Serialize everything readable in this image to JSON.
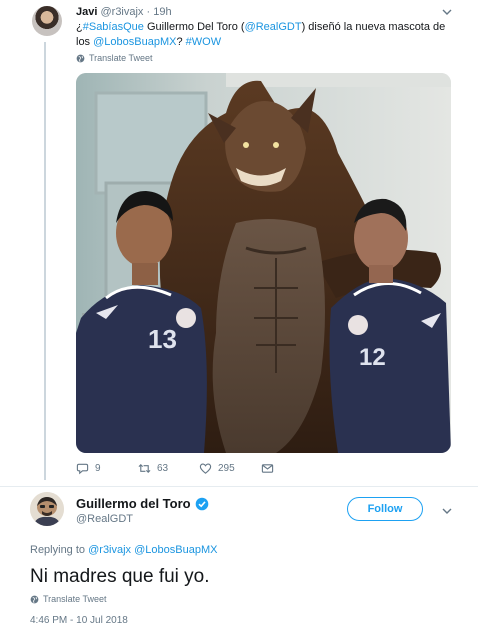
{
  "context_tweet": {
    "author_name": "Javi",
    "handle": "@r3ivajx",
    "separator": "·",
    "age": "19h",
    "text_parts": [
      {
        "kind": "text",
        "value": "¿"
      },
      {
        "kind": "link",
        "value": "#SabíasQue"
      },
      {
        "kind": "text",
        "value": " Guillermo Del Toro ("
      },
      {
        "kind": "link",
        "value": "@RealGDT"
      },
      {
        "kind": "text",
        "value": ") diseñó la nueva mascota de los "
      },
      {
        "kind": "link",
        "value": "@LobosBuapMX"
      },
      {
        "kind": "text",
        "value": "? "
      },
      {
        "kind": "link",
        "value": "#WOW"
      }
    ],
    "translate_label": "Translate Tweet",
    "photo": {
      "jersey_numbers": [
        "13",
        "12"
      ]
    },
    "actions": {
      "replies": "9",
      "retweets": "63",
      "likes": "295"
    }
  },
  "main_tweet": {
    "author_name": "Guillermo del Toro",
    "handle": "@RealGDT",
    "verified": true,
    "follow_label": "Follow",
    "replying_prefix": "Replying to",
    "replying_to": [
      "@r3ivajx",
      "@LobosBuapMX"
    ],
    "text": "Ni madres que fui yo.",
    "translate_label": "Translate Tweet",
    "timestamp": "4:46 PM - 10 Jul 2018"
  },
  "colors": {
    "link": "#1b95e0",
    "follow": "#1da1f2",
    "muted": "#657786",
    "retweet_green": "#17bf63"
  },
  "icons": [
    "chevron-down-icon",
    "globe-icon",
    "reply-icon",
    "retweet-icon",
    "like-icon",
    "direct-message-icon",
    "verified-badge-icon"
  ]
}
